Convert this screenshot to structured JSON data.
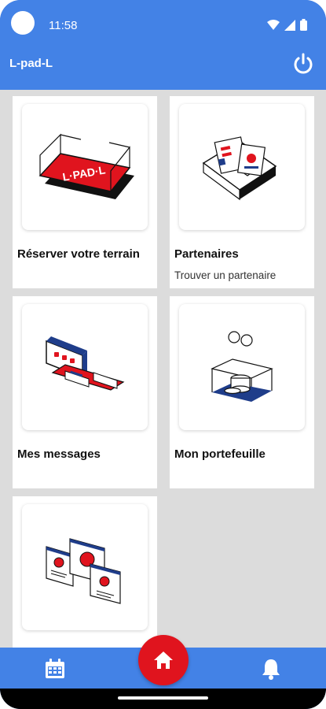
{
  "status_bar": {
    "time": "11:58"
  },
  "app_bar": {
    "title": "L-pad-L"
  },
  "tiles": [
    {
      "title": "Réserver votre terrain",
      "subtitle": "",
      "logo_text": "L·PAD·L"
    },
    {
      "title": "Partenaires",
      "subtitle": "Trouver un partenaire"
    },
    {
      "title": "Mes messages",
      "subtitle": ""
    },
    {
      "title": "Mon portefeuille",
      "subtitle": ""
    },
    {
      "title": "",
      "subtitle": ""
    }
  ],
  "icons": {
    "power": "power-icon",
    "calendar": "calendar-icon",
    "home": "home-icon",
    "bell": "bell-icon"
  },
  "colors": {
    "primary": "#4382e6",
    "accent_red": "#e0141e",
    "navy": "#1f3d8a",
    "background": "#dcdcdc"
  }
}
